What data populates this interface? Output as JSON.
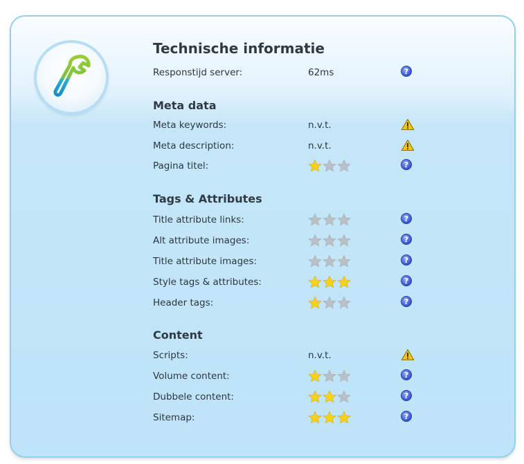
{
  "header": {
    "title": "Technische informatie"
  },
  "badge": {
    "icon": "wrench-icon",
    "colors": [
      "#8dc63f",
      "#1aa3cc"
    ]
  },
  "server": {
    "label": "Responstijd server:",
    "value": "62ms",
    "status": "help"
  },
  "sections": [
    {
      "title": "Meta data",
      "rows": [
        {
          "label": "Meta keywords:",
          "value": "n.v.t.",
          "status": "warning"
        },
        {
          "label": "Meta description:",
          "value": "n.v.t.",
          "status": "warning"
        },
        {
          "label": "Pagina titel:",
          "rating": 1,
          "status": "help"
        }
      ]
    },
    {
      "title": "Tags & Attributes",
      "rows": [
        {
          "label": "Title attribute links:",
          "rating": 0,
          "status": "help"
        },
        {
          "label": "Alt attribute images:",
          "rating": 0,
          "status": "help"
        },
        {
          "label": "Title attribute images:",
          "rating": 0,
          "status": "help"
        },
        {
          "label": "Style tags & attributes:",
          "rating": 3,
          "status": "help"
        },
        {
          "label": "Header tags:",
          "rating": 1,
          "status": "help"
        }
      ]
    },
    {
      "title": "Content",
      "rows": [
        {
          "label": "Scripts:",
          "value": "n.v.t.",
          "status": "warning"
        },
        {
          "label": "Volume content:",
          "rating": 1,
          "status": "help"
        },
        {
          "label": "Dubbele content:",
          "rating": 2,
          "status": "help"
        },
        {
          "label": "Sitemap:",
          "rating": 3,
          "status": "help"
        }
      ]
    }
  ],
  "rating_max": 3,
  "colors": {
    "star_on": "#f7d21a",
    "star_off": "#b9c0c6",
    "help": "#3454d1",
    "warning": "#f2c318"
  },
  "icons": {
    "help": "question-mark-icon",
    "warning": "warning-triangle-icon"
  },
  "help_glyph": "?"
}
